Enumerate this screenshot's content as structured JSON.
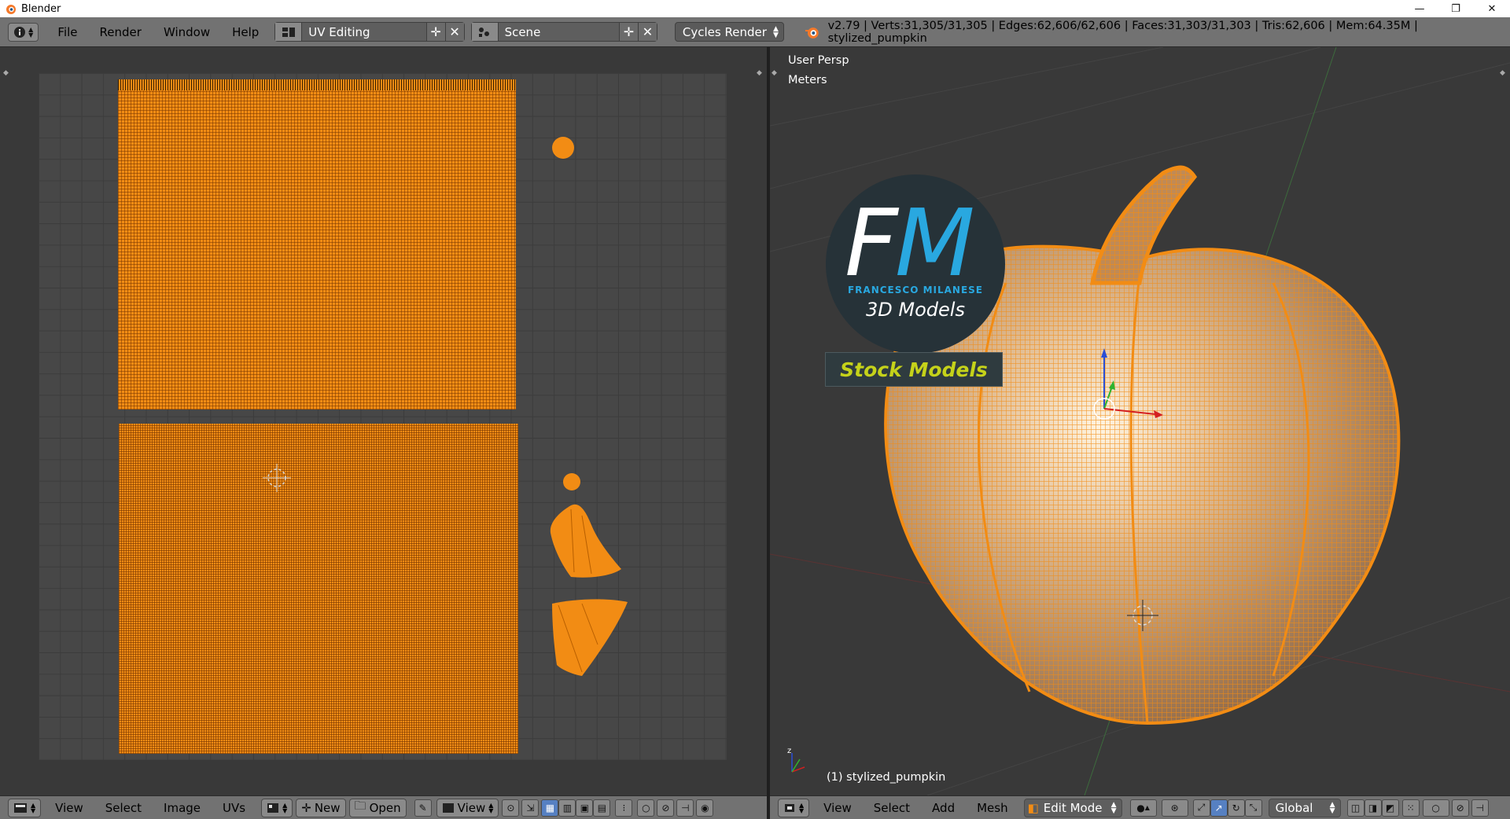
{
  "window": {
    "title": "Blender",
    "controls": {
      "minimize": "—",
      "maximize": "❐",
      "close": "✕"
    }
  },
  "info_header": {
    "menus": [
      "File",
      "Render",
      "Window",
      "Help"
    ],
    "layout": "UV Editing",
    "scene": "Scene",
    "render_engine": "Cycles Render",
    "stats": "v2.79 | Verts:31,305/31,305 | Edges:62,606/62,606 | Faces:31,303/31,303 | Tris:62,606 | Mem:64.35M | stylized_pumpkin"
  },
  "uv_editor": {
    "footer_menus": [
      "View",
      "Select",
      "Image",
      "UVs"
    ],
    "new_label": "New",
    "open_label": "Open",
    "view_label": "View",
    "island_color": "#f28c14"
  },
  "viewport": {
    "view_name": "User Persp",
    "units": "Meters",
    "object_label": "(1) stylized_pumpkin",
    "footer_menus": [
      "View",
      "Select",
      "Add",
      "Mesh"
    ],
    "mode": "Edit Mode",
    "orientation": "Global"
  },
  "watermark": {
    "letters_f": "F",
    "letters_m": "M",
    "name": "FRANCESCO MILANESE",
    "sub": "3D Models",
    "stock": "Stock Models",
    "accent": "#29a8e0",
    "stock_color": "#c5d21a"
  },
  "colors": {
    "header_gray": "#727272",
    "area_bg": "#393939",
    "mesh_orange": "#f28c14"
  }
}
